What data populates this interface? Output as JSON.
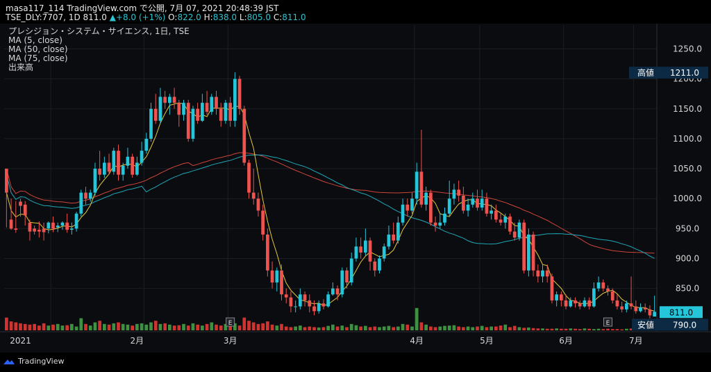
{
  "header": {
    "line1": "masa117_114 TradingView.com で公開, 7月 07, 2021 20:48:39 JST",
    "symbol": "TSE_DLY:7707, 1D 811.0",
    "change": "▲+8.0 (+1%)",
    "o_label": "O:",
    "o_value": "822.0",
    "h_label": "H:",
    "h_value": "838.0",
    "l_label": "L:",
    "l_value": "805.0",
    "c_label": "C:",
    "c_value": "811.0"
  },
  "legend": {
    "title": "プレシジョン・システム・サイエンス, 1日, TSE",
    "ma5": "MA (5, close)",
    "ma50": "MA (50, close)",
    "ma75": "MA (75, close)",
    "volume": "出来高"
  },
  "footer": {
    "brand": "TradingView"
  },
  "colors": {
    "up": "#26c6da",
    "down": "#ef5350",
    "vol_up": "#43a047",
    "vol_down": "#e53935",
    "ma5": "#e6c93c",
    "ma50": "#1fa9b8",
    "ma75": "#d0453b",
    "grid": "#1b1e22",
    "text": "#d8d8d8"
  },
  "chart_data": {
    "type": "candlestick",
    "ylim": [
      780,
      1290
    ],
    "y_ticks": [
      "1250.0",
      "1200.0",
      "1150.0",
      "1100.0",
      "1050.0",
      "1000.0",
      "950.0",
      "900.0",
      "850.0"
    ],
    "x_labels": [
      "2021",
      "2月",
      "3月",
      "4月",
      "5月",
      "6月",
      "7月"
    ],
    "markers": {
      "high_label": "高値",
      "high_value": "1211.0",
      "low_label": "安値",
      "low_value": "790.0",
      "last_value": "811.0"
    },
    "earnings_label": "E",
    "candles": [
      [
        1050,
        1010,
        1040,
        952
      ],
      [
        965,
        950,
        1000,
        948
      ],
      [
        950,
        948,
        996,
        943
      ],
      [
        995,
        988,
        1000,
        970
      ],
      [
        990,
        972,
        996,
        955
      ],
      [
        960,
        945,
        965,
        930
      ],
      [
        950,
        945,
        955,
        940
      ],
      [
        948,
        945,
        962,
        935
      ],
      [
        950,
        944,
        960,
        930
      ],
      [
        950,
        960,
        962,
        942
      ],
      [
        960,
        950,
        970,
        944
      ],
      [
        952,
        955,
        960,
        944
      ],
      [
        955,
        960,
        962,
        948
      ],
      [
        960,
        948,
        975,
        943
      ],
      [
        948,
        950,
        960,
        940
      ],
      [
        950,
        975,
        978,
        945
      ],
      [
        975,
        1010,
        1015,
        970
      ],
      [
        1010,
        1000,
        1020,
        990
      ],
      [
        1000,
        1010,
        1015,
        995
      ],
      [
        1010,
        1050,
        1060,
        1005
      ],
      [
        1050,
        1040,
        1080,
        1030
      ],
      [
        1040,
        1060,
        1070,
        1035
      ],
      [
        1060,
        1045,
        1075,
        1040
      ],
      [
        1045,
        1080,
        1085,
        1040
      ],
      [
        1080,
        1040,
        1090,
        1030
      ],
      [
        1040,
        1055,
        1060,
        1030
      ],
      [
        1055,
        1070,
        1085,
        1050
      ],
      [
        1070,
        1040,
        1075,
        1035
      ],
      [
        1040,
        1060,
        1070,
        1038
      ],
      [
        1060,
        1080,
        1095,
        1055
      ],
      [
        1080,
        1100,
        1110,
        1075
      ],
      [
        1100,
        1150,
        1160,
        1095
      ],
      [
        1150,
        1130,
        1175,
        1125
      ],
      [
        1130,
        1170,
        1185,
        1125
      ],
      [
        1170,
        1160,
        1180,
        1150
      ],
      [
        1160,
        1170,
        1175,
        1140
      ],
      [
        1170,
        1160,
        1185,
        1150
      ],
      [
        1160,
        1140,
        1165,
        1120
      ],
      [
        1140,
        1160,
        1165,
        1130
      ],
      [
        1160,
        1100,
        1165,
        1095
      ],
      [
        1100,
        1150,
        1155,
        1095
      ],
      [
        1150,
        1130,
        1160,
        1125
      ],
      [
        1130,
        1160,
        1175,
        1128
      ],
      [
        1160,
        1145,
        1180,
        1140
      ],
      [
        1145,
        1170,
        1175,
        1140
      ],
      [
        1170,
        1150,
        1180,
        1140
      ],
      [
        1150,
        1130,
        1160,
        1120
      ],
      [
        1130,
        1160,
        1165,
        1125
      ],
      [
        1160,
        1130,
        1170,
        1120
      ],
      [
        1130,
        1200,
        1211,
        1120
      ],
      [
        1200,
        1150,
        1205,
        1140
      ],
      [
        1150,
        1060,
        1155,
        1055
      ],
      [
        1060,
        1010,
        1065,
        1000
      ],
      [
        1010,
        1000,
        1050,
        990
      ],
      [
        1000,
        980,
        1010,
        970
      ],
      [
        980,
        940,
        990,
        930
      ],
      [
        940,
        880,
        950,
        870
      ],
      [
        880,
        860,
        895,
        850
      ],
      [
        860,
        880,
        885,
        845
      ],
      [
        880,
        840,
        890,
        830
      ],
      [
        840,
        835,
        850,
        825
      ],
      [
        835,
        820,
        845,
        810
      ],
      [
        820,
        820,
        830,
        810
      ],
      [
        820,
        840,
        850,
        815
      ],
      [
        840,
        830,
        845,
        820
      ],
      [
        830,
        820,
        840,
        810
      ],
      [
        820,
        812,
        830,
        805
      ],
      [
        812,
        825,
        830,
        808
      ],
      [
        825,
        820,
        832,
        815
      ],
      [
        820,
        840,
        845,
        818
      ],
      [
        840,
        850,
        860,
        838
      ],
      [
        850,
        840,
        855,
        830
      ],
      [
        840,
        880,
        885,
        835
      ],
      [
        880,
        860,
        885,
        850
      ],
      [
        860,
        900,
        910,
        855
      ],
      [
        900,
        920,
        935,
        895
      ],
      [
        920,
        910,
        935,
        900
      ],
      [
        910,
        930,
        950,
        905
      ],
      [
        930,
        895,
        935,
        880
      ],
      [
        895,
        880,
        900,
        870
      ],
      [
        880,
        900,
        905,
        875
      ],
      [
        900,
        920,
        925,
        895
      ],
      [
        920,
        940,
        955,
        915
      ],
      [
        940,
        930,
        960,
        925
      ],
      [
        930,
        960,
        970,
        925
      ],
      [
        960,
        990,
        1000,
        955
      ],
      [
        990,
        980,
        1000,
        970
      ],
      [
        980,
        1000,
        1010,
        975
      ],
      [
        1000,
        1045,
        1060,
        990
      ],
      [
        1045,
        990,
        1115,
        985
      ],
      [
        990,
        1010,
        1020,
        980
      ],
      [
        1010,
        960,
        1015,
        955
      ],
      [
        960,
        955,
        970,
        945
      ],
      [
        955,
        960,
        975,
        950
      ],
      [
        960,
        975,
        985,
        955
      ],
      [
        975,
        1000,
        1030,
        970
      ],
      [
        1000,
        1015,
        1025,
        990
      ],
      [
        1015,
        1005,
        1030,
        995
      ],
      [
        1005,
        980,
        1020,
        975
      ],
      [
        980,
        990,
        1000,
        970
      ],
      [
        990,
        1000,
        1010,
        985
      ],
      [
        1000,
        985,
        1015,
        980
      ],
      [
        985,
        1000,
        1015,
        980
      ],
      [
        1000,
        975,
        1010,
        970
      ],
      [
        975,
        980,
        990,
        965
      ],
      [
        980,
        965,
        990,
        960
      ],
      [
        965,
        960,
        975,
        955
      ],
      [
        960,
        970,
        975,
        950
      ],
      [
        970,
        945,
        975,
        940
      ],
      [
        945,
        935,
        960,
        930
      ],
      [
        935,
        960,
        965,
        930
      ],
      [
        960,
        880,
        965,
        875
      ],
      [
        880,
        940,
        950,
        870
      ],
      [
        940,
        880,
        945,
        870
      ],
      [
        880,
        870,
        890,
        860
      ],
      [
        870,
        880,
        890,
        860
      ],
      [
        880,
        870,
        890,
        860
      ],
      [
        870,
        830,
        875,
        825
      ],
      [
        830,
        840,
        845,
        820
      ],
      [
        840,
        830,
        845,
        820
      ],
      [
        830,
        820,
        840,
        815
      ],
      [
        820,
        830,
        835,
        818
      ],
      [
        830,
        825,
        835,
        818
      ],
      [
        825,
        820,
        830,
        815
      ],
      [
        820,
        830,
        835,
        818
      ],
      [
        830,
        820,
        835,
        815
      ],
      [
        820,
        850,
        860,
        818
      ],
      [
        850,
        860,
        870,
        845
      ],
      [
        860,
        850,
        865,
        845
      ],
      [
        850,
        845,
        855,
        838
      ],
      [
        845,
        830,
        850,
        825
      ],
      [
        830,
        820,
        840,
        815
      ],
      [
        820,
        815,
        828,
        810
      ],
      [
        815,
        825,
        830,
        810
      ],
      [
        825,
        820,
        870,
        815
      ],
      [
        820,
        812,
        830,
        808
      ],
      [
        812,
        818,
        825,
        810
      ],
      [
        818,
        815,
        825,
        810
      ],
      [
        815,
        805,
        822,
        800
      ],
      [
        803,
        811,
        838,
        805
      ]
    ],
    "volume_max": 100,
    "volumes": [
      40,
      28,
      25,
      22,
      20,
      18,
      20,
      15,
      22,
      15,
      18,
      20,
      15,
      16,
      20,
      12,
      38,
      20,
      15,
      25,
      30,
      20,
      18,
      22,
      25,
      20,
      18,
      15,
      20,
      22,
      18,
      25,
      30,
      20,
      22,
      18,
      15,
      16,
      20,
      15,
      22,
      18,
      15,
      20,
      25,
      18,
      15,
      20,
      18,
      22,
      15,
      40,
      30,
      25,
      20,
      22,
      28,
      18,
      15,
      20,
      12,
      10,
      12,
      15,
      10,
      12,
      10,
      9,
      10,
      14,
      18,
      12,
      15,
      10,
      20,
      16,
      12,
      14,
      10,
      12,
      10,
      12,
      14,
      10,
      12,
      20,
      18,
      12,
      70,
      25,
      18,
      12,
      10,
      12,
      14,
      15,
      16,
      12,
      10,
      12,
      10,
      12,
      14,
      10,
      12,
      12,
      15,
      18,
      10,
      14,
      10,
      8,
      9,
      7,
      6,
      6,
      5,
      5,
      6,
      5,
      5,
      6,
      5,
      4,
      6,
      5,
      4,
      5,
      4,
      5,
      4,
      4,
      3,
      5,
      6,
      5,
      5,
      4,
      6,
      5
    ],
    "ma5": [],
    "ma50": [],
    "ma75": []
  }
}
